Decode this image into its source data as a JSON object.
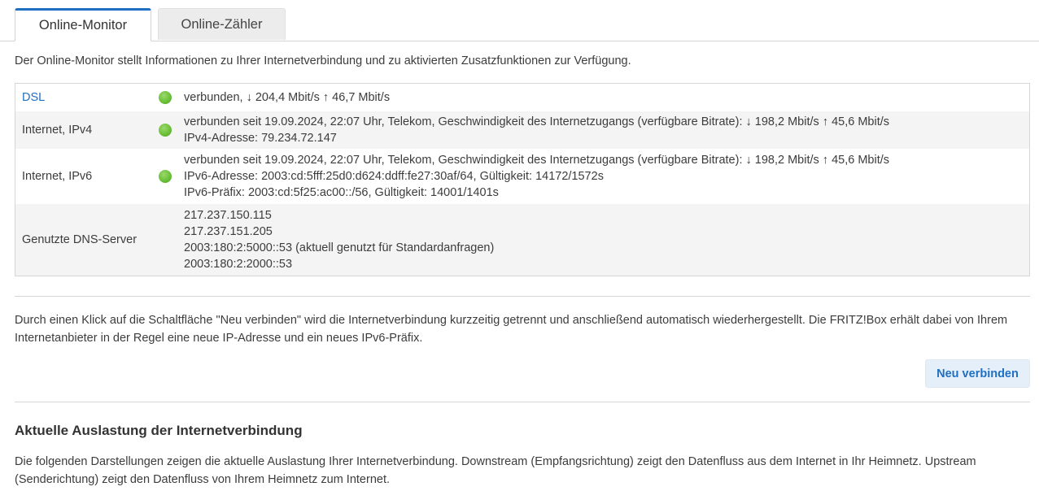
{
  "tabs": [
    {
      "label": "Online-Monitor",
      "active": true
    },
    {
      "label": "Online-Zähler",
      "active": false
    }
  ],
  "intro": "Der Online-Monitor stellt Informationen zu Ihrer Internetverbindung und zu aktivierten Zusatzfunktionen zur Verfügung.",
  "status_rows": {
    "dsl": {
      "label": "DSL",
      "status": "connected",
      "lines": [
        "verbunden, ↓ 204,4 Mbit/s ↑ 46,7 Mbit/s"
      ]
    },
    "ipv4": {
      "label": "Internet, IPv4",
      "status": "connected",
      "lines": [
        "verbunden seit 19.09.2024, 22:07 Uhr, Telekom, Geschwindigkeit des Internetzugangs (verfügbare Bitrate): ↓ 198,2 Mbit/s ↑ 45,6 Mbit/s",
        "IPv4-Adresse: 79.234.72.147"
      ]
    },
    "ipv6": {
      "label": "Internet, IPv6",
      "status": "connected",
      "lines": [
        "verbunden seit 19.09.2024, 22:07 Uhr, Telekom, Geschwindigkeit des Internetzugangs (verfügbare Bitrate): ↓ 198,2 Mbit/s ↑ 45,6 Mbit/s",
        "IPv6-Adresse: 2003:cd:5fff:25d0:d624:ddff:fe27:30af/64, Gültigkeit: 14172/1572s",
        "IPv6-Präfix: 2003:cd:5f25:ac00::/56, Gültigkeit: 14001/1401s"
      ]
    },
    "dns": {
      "label": "Genutzte DNS-Server",
      "lines": [
        "217.237.150.115",
        "217.237.151.205",
        "2003:180:2:5000::53 (aktuell genutzt für Standardanfragen)",
        "2003:180:2:2000::53"
      ]
    }
  },
  "reconnect": {
    "text": "Durch einen Klick auf die Schaltfläche \"Neu verbinden\" wird die Internetverbindung kurzzeitig getrennt und anschließend automatisch wiederhergestellt. Die FRITZ!Box erhält dabei von Ihrem Internetanbieter in der Regel eine neue IP-Adresse und ein neues IPv6-Präfix.",
    "button_label": "Neu verbinden"
  },
  "load_section": {
    "heading": "Aktuelle Auslastung der Internetverbindung",
    "text": "Die folgenden Darstellungen zeigen die aktuelle Auslastung Ihrer Internetverbindung. Downstream (Empfangsrichtung) zeigt den Datenfluss aus dem Internet in Ihr Heimnetz. Upstream (Senderichtung) zeigt den Datenfluss von Ihrem Heimnetz zum Internet."
  },
  "colors": {
    "accent": "#1f6fc4",
    "status_ok": "#6cc13a",
    "button_bg": "#e5eff9"
  }
}
